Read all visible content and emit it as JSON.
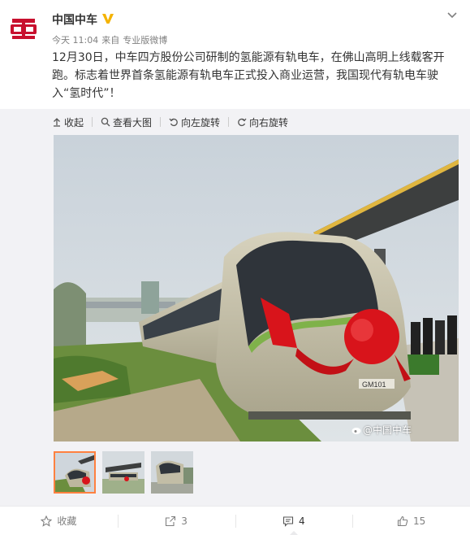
{
  "user": {
    "name": "中国中车",
    "verified": true
  },
  "meta": {
    "time": "今天 11:04",
    "source_prefix": "来自",
    "source": "专业版微博"
  },
  "post": {
    "text": "12月30日，中车四方股份公司研制的氢能源有轨电车，在佛山高明上线载客开跑。标志着世界首条氢能源有轨电车正式投入商业运营，我国现代有轨电车驶入“氢时代”！"
  },
  "toolbar": {
    "collapse": "收起",
    "view_large": "查看大图",
    "rotate_left": "向左旋转",
    "rotate_right": "向右旋转"
  },
  "photo": {
    "watermark": "@中国中车",
    "plate": "GM101"
  },
  "actions": {
    "favorite": "收藏",
    "repost_count": "3",
    "comment_count": "4",
    "like_count": "15"
  },
  "colors": {
    "brand_red": "#c8102e",
    "verified_yellow": "#f4b300",
    "thumb_active": "#ff8140"
  }
}
